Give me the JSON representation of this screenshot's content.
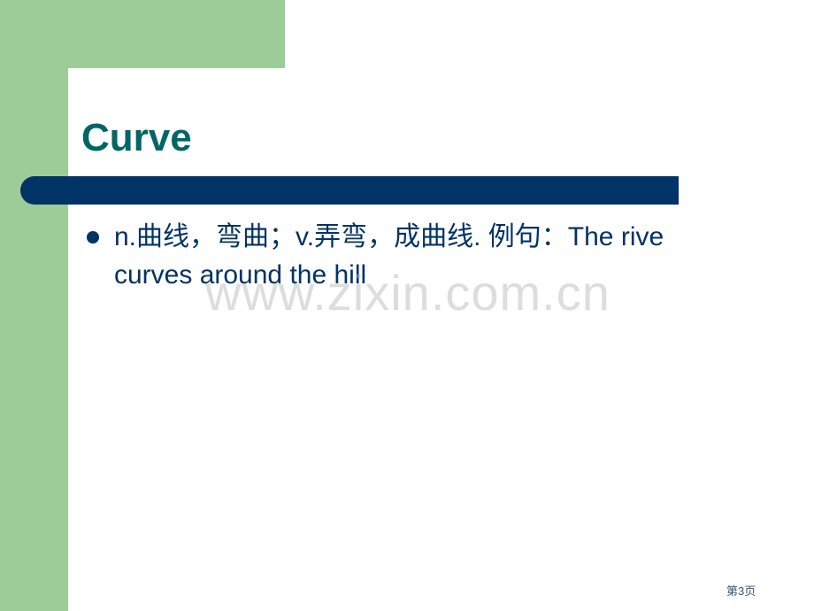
{
  "slide": {
    "title": "Curve",
    "bullets": [
      {
        "text": "n.曲线，弯曲；v.弄弯，成曲线. 例句：The rive curves around the hill"
      }
    ],
    "watermark": "www.zixin.com.cn",
    "page_number": "第3页"
  },
  "colors": {
    "green": "#9dcc98",
    "navy": "#003366",
    "title_teal": "#006666"
  }
}
